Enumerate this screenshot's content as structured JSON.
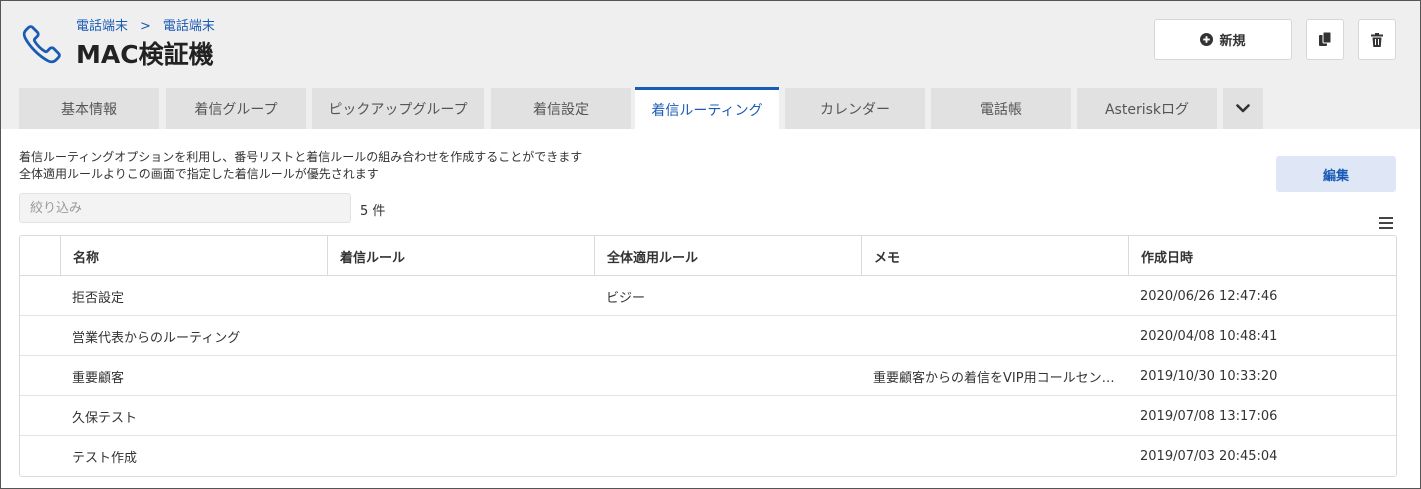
{
  "header": {
    "breadcrumb": [
      "電話端末",
      "電話端末"
    ],
    "breadcrumb_separator": ">",
    "title": "MAC検証機",
    "new_label": "新規",
    "icon_color": "#1a5bb5"
  },
  "tabs": [
    {
      "label": "基本情報"
    },
    {
      "label": "着信グループ"
    },
    {
      "label": "ピックアップグループ"
    },
    {
      "label": "着信設定"
    },
    {
      "label": "着信ルーティング",
      "active": true
    },
    {
      "label": "カレンダー"
    },
    {
      "label": "電話帳"
    },
    {
      "label": "Asteriskログ"
    }
  ],
  "content": {
    "description_line1": "着信ルーティングオプションを利用し、番号リストと着信ルールの組み合わせを作成することができます",
    "description_line2": "全体適用ルールよりこの画面で指定した着信ルールが優先されます",
    "edit_label": "編集",
    "filter_placeholder": "絞り込み",
    "count": "5 件"
  },
  "table": {
    "columns": [
      "名称",
      "着信ルール",
      "全体適用ルール",
      "メモ",
      "作成日時"
    ],
    "rows": [
      {
        "name": "拒否設定",
        "rule": "",
        "global_rule": "ビジー",
        "memo": "",
        "created": "2020/06/26 12:47:46"
      },
      {
        "name": "営業代表からのルーティング",
        "rule": "",
        "global_rule": "",
        "memo": "",
        "created": "2020/04/08 10:48:41"
      },
      {
        "name": "重要顧客",
        "rule": "",
        "global_rule": "",
        "memo": "重要顧客からの着信をVIP用コールセン…",
        "created": "2019/10/30 10:33:20"
      },
      {
        "name": "久保テスト",
        "rule": "",
        "global_rule": "",
        "memo": "",
        "created": "2019/07/08 13:17:06"
      },
      {
        "name": "テスト作成",
        "rule": "",
        "global_rule": "",
        "memo": "",
        "created": "2019/07/03 20:45:04"
      }
    ]
  }
}
